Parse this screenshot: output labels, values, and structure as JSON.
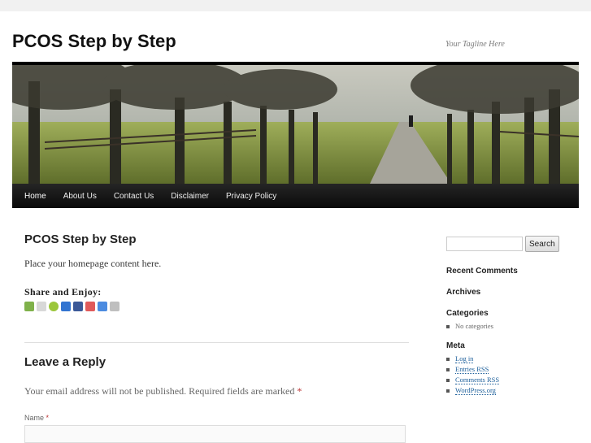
{
  "site": {
    "title": "PCOS Step by Step",
    "tagline": "Your Tagline Here"
  },
  "nav": {
    "items": [
      {
        "label": "Home",
        "current": true
      },
      {
        "label": "About Us",
        "current": false
      },
      {
        "label": "Contact Us",
        "current": false
      },
      {
        "label": "Disclaimer",
        "current": false
      },
      {
        "label": "Privacy Policy",
        "current": false
      }
    ]
  },
  "post": {
    "title": "PCOS Step by Step",
    "content": "Place your homepage content here.",
    "share_heading": "Share and Enjoy:",
    "share_icons": [
      {
        "name": "print-icon",
        "color": "#7fb14a"
      },
      {
        "name": "digg-icon",
        "color": "#d8d8d8"
      },
      {
        "name": "android-icon",
        "color": "#9bc63a"
      },
      {
        "name": "delicious-icon",
        "color": "#3274d1"
      },
      {
        "name": "facebook-icon",
        "color": "#3b5998"
      },
      {
        "name": "email-icon",
        "color": "#e05a5a"
      },
      {
        "name": "google-icon",
        "color": "#4b8be0"
      },
      {
        "name": "info-icon",
        "color": "#bfbfbf"
      }
    ]
  },
  "comments": {
    "title": "Leave a Reply",
    "notes": "Your email address will not be published. Required fields are marked",
    "required_mark": "*",
    "name_label": "Name"
  },
  "sidebar": {
    "search_button": "Search",
    "recent_comments_title": "Recent Comments",
    "archives_title": "Archives",
    "categories_title": "Categories",
    "categories_items": [
      "No categories"
    ],
    "meta_title": "Meta",
    "meta_items": [
      "Log in",
      "Entries RSS",
      "Comments RSS",
      "WordPress.org"
    ]
  }
}
